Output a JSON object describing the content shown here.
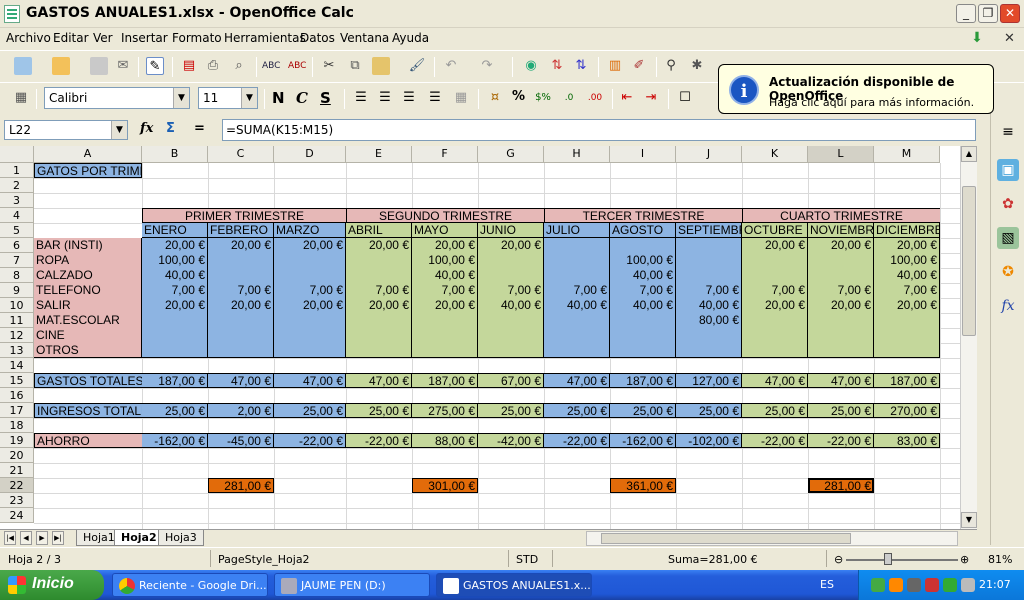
{
  "window": {
    "title": "GASTOS ANUALES1.xlsx - OpenOffice Calc",
    "minimize": "_",
    "maximize": "❐",
    "close": "✕"
  },
  "menu": [
    "Archivo",
    "Editar",
    "Ver",
    "Insertar",
    "Formato",
    "Herramientas",
    "Datos",
    "Ventana",
    "Ayuda"
  ],
  "format_toolbar": {
    "font_name": "Calibri",
    "font_size": "11",
    "bold": "N",
    "italic": "C",
    "underline": "S",
    "percent": "%"
  },
  "balloon": {
    "title": "Actualización disponible de OpenOffice",
    "text": "Haga clic aquí para más información.",
    "icon": "i"
  },
  "formula_bar": {
    "cell_ref": "L22",
    "formula": "=SUMA(K15:M15)",
    "fx": "fx",
    "sigma": "Σ",
    "equals": "="
  },
  "columns": [
    "A",
    "B",
    "C",
    "D",
    "E",
    "F",
    "G",
    "H",
    "I",
    "J",
    "K",
    "L",
    "M"
  ],
  "active_column": "L",
  "active_row": "22",
  "rows": [
    "1",
    "2",
    "3",
    "4",
    "5",
    "6",
    "7",
    "8",
    "9",
    "10",
    "11",
    "12",
    "13",
    "14",
    "15",
    "16",
    "17",
    "18",
    "19",
    "20",
    "21",
    "22",
    "23",
    "24"
  ],
  "sheet": {
    "a1": "GATOS POR TRIMESTRE",
    "quarters": [
      "PRIMER TRIMESTRE",
      "SEGUNDO TRIMESTRE",
      "TERCER TRIMESTRE",
      "CUARTO TRIMESTRE"
    ],
    "months": [
      "ENERO",
      "FEBRERO",
      "MARZO",
      "ABRIL",
      "MAYO",
      "JUNIO",
      "JULIO",
      "AGOSTO",
      "SEPTIEMBRE",
      "OCTUBRE",
      "NOVIEMBRE",
      "DICIEMBRE"
    ],
    "categories": [
      {
        "label": "BAR (INSTI)",
        "values": [
          "20,00 €",
          "20,00 €",
          "20,00 €",
          "20,00 €",
          "20,00 €",
          "20,00 €",
          "",
          "",
          "",
          "20,00 €",
          "20,00 €",
          "20,00 €"
        ]
      },
      {
        "label": "ROPA",
        "values": [
          "100,00 €",
          "",
          "",
          "",
          "100,00 €",
          "",
          "",
          "100,00 €",
          "",
          "",
          "",
          "100,00 €"
        ]
      },
      {
        "label": "CALZADO",
        "values": [
          "40,00 €",
          "",
          "",
          "",
          "40,00 €",
          "",
          "",
          "40,00 €",
          "",
          "",
          "",
          "40,00 €"
        ]
      },
      {
        "label": "TELEFONO",
        "values": [
          "7,00 €",
          "7,00 €",
          "7,00 €",
          "7,00 €",
          "7,00 €",
          "7,00 €",
          "7,00 €",
          "7,00 €",
          "7,00 €",
          "7,00 €",
          "7,00 €",
          "7,00 €"
        ]
      },
      {
        "label": "SALIR",
        "values": [
          "20,00 €",
          "20,00 €",
          "20,00 €",
          "20,00 €",
          "20,00 €",
          "40,00 €",
          "40,00 €",
          "40,00 €",
          "40,00 €",
          "20,00 €",
          "20,00 €",
          "20,00 €"
        ]
      },
      {
        "label": "MAT.ESCOLAR",
        "values": [
          "",
          "",
          "",
          "",
          "",
          "",
          "",
          "",
          "80,00 €",
          "",
          "",
          ""
        ]
      },
      {
        "label": "CINE",
        "values": [
          "",
          "",
          "",
          "",
          "",
          "",
          "",
          "",
          "",
          "",
          "",
          ""
        ]
      },
      {
        "label": "OTROS",
        "values": [
          "",
          "",
          "",
          "",
          "",
          "",
          "",
          "",
          "",
          "",
          "",
          ""
        ]
      }
    ],
    "gastos_totales": {
      "label": "GASTOS TOTALES",
      "values": [
        "187,00 €",
        "47,00 €",
        "47,00 €",
        "47,00 €",
        "187,00 €",
        "67,00 €",
        "47,00 €",
        "187,00 €",
        "127,00 €",
        "47,00 €",
        "47,00 €",
        "187,00 €"
      ]
    },
    "ingresos_totales": {
      "label": "INGRESOS TOTALES",
      "values": [
        "25,00 €",
        "2,00 €",
        "25,00 €",
        "25,00 €",
        "275,00 €",
        "25,00 €",
        "25,00 €",
        "25,00 €",
        "25,00 €",
        "25,00 €",
        "25,00 €",
        "270,00 €"
      ]
    },
    "ahorro": {
      "label": "AHORRO",
      "values": [
        "-162,00 €",
        "-45,00 €",
        "-22,00 €",
        "-22,00 €",
        "88,00 €",
        "-42,00 €",
        "-22,00 €",
        "-162,00 €",
        "-102,00 €",
        "-22,00 €",
        "-22,00 €",
        "83,00 €"
      ]
    },
    "quarter_totals": [
      "281,00 €",
      "301,00 €",
      "361,00 €",
      "281,00 €"
    ]
  },
  "sheet_tabs": [
    "Hoja1",
    "Hoja2",
    "Hoja3"
  ],
  "active_sheet": "Hoja2",
  "status": {
    "sheet": "Hoja 2 / 3",
    "page_style": "PageStyle_Hoja2",
    "mode": "STD",
    "sum": "Suma=281,00 €",
    "zoom": "81%"
  },
  "taskbar": {
    "start": "Inicio",
    "tasks": [
      "Reciente - Google Dri...",
      "JAUME PEN (D:)",
      "GASTOS ANUALES1.x..."
    ],
    "lang": "ES",
    "clock": "21:07"
  },
  "colors": {
    "blue": "#8db4e2",
    "green": "#c4d79b",
    "pink": "#e6b8b7",
    "orange": "#e26b0a",
    "header_blue": "#8db4e2"
  }
}
